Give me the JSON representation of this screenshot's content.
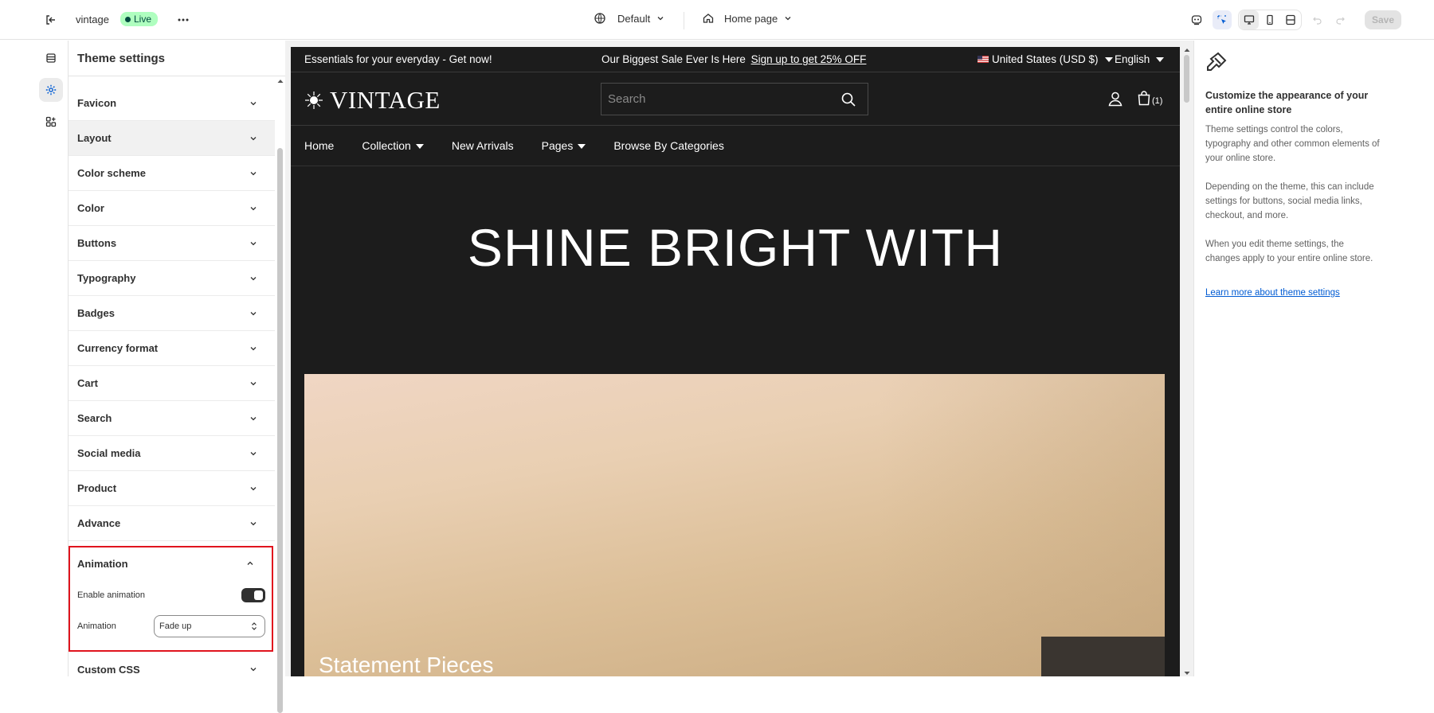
{
  "topbar": {
    "store_name": "vintage",
    "status_badge": "Live",
    "theme_selector": "Default",
    "page_selector": "Home page",
    "save_label": "Save"
  },
  "settings": {
    "title": "Theme settings",
    "items": [
      {
        "label": "Favicon"
      },
      {
        "label": "Layout"
      },
      {
        "label": "Color scheme"
      },
      {
        "label": "Color"
      },
      {
        "label": "Buttons"
      },
      {
        "label": "Typography"
      },
      {
        "label": "Badges"
      },
      {
        "label": "Currency format"
      },
      {
        "label": "Cart"
      },
      {
        "label": "Search"
      },
      {
        "label": "Social media"
      },
      {
        "label": "Product"
      },
      {
        "label": "Advance"
      }
    ],
    "animation": {
      "label": "Animation",
      "enable_label": "Enable animation",
      "enabled": true,
      "select_label": "Animation",
      "select_value": "Fade up"
    },
    "custom_css_label": "Custom CSS"
  },
  "preview": {
    "announcement_left": "Essentials for your everyday - Get now!",
    "announcement_center": "Our Biggest Sale Ever Is Here",
    "announcement_link": "Sign up to get 25% OFF",
    "country": "United States (USD $)",
    "language": "English",
    "logo": "VINTAGE",
    "search_placeholder": "Search",
    "cart_count": "(1)",
    "nav": {
      "home": "Home",
      "collection": "Collection",
      "new_arrivals": "New Arrivals",
      "pages": "Pages",
      "browse": "Browse By Categories"
    },
    "hero_title": "SHINE BRIGHT WITH",
    "hero_caption": "Statement Pieces"
  },
  "info": {
    "heading": "Customize the appearance of your entire online store",
    "p1": "Theme settings control the colors, typography and other common elements of your online store.",
    "p2": "Depending on the theme, this can include settings for buttons, social media links, checkout, and more.",
    "p3": "When you edit theme settings, the changes apply to your entire online store.",
    "link": "Learn more about theme settings"
  }
}
